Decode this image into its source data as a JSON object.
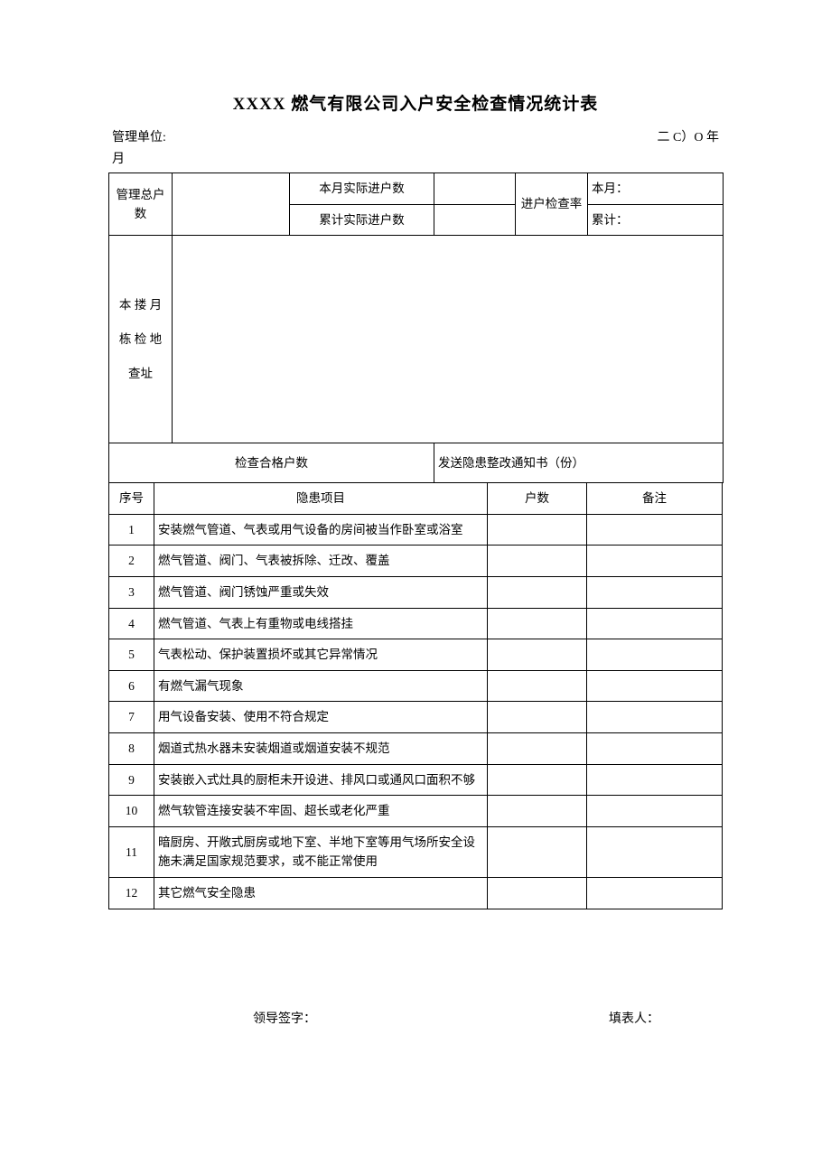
{
  "title": "XXXX 燃气有限公司入户安全检查情况统计表",
  "meta": {
    "unit_label": "管理单位:",
    "year_label": "二 C）O 年",
    "month_label": "月"
  },
  "upper": {
    "mgmt_total": "管理总户数",
    "this_month_actual": "本月实际进户数",
    "cumu_actual": "累计实际进户数",
    "entry_rate": "进户检查率",
    "this_month": "本月：",
    "cumu": "累计：",
    "block_addr_a": "本 搂 月",
    "block_addr_b": "栋 检 地",
    "block_addr_c": "查址",
    "qualified": "检查合格户数",
    "notice": "发送隐患整改通知书（份）"
  },
  "cols": {
    "seq": "序号",
    "hazard": "隐患项目",
    "count": "户数",
    "remark": "备注"
  },
  "rows": [
    {
      "no": "1",
      "item": "安装燃气管道、气表或用气设备的房间被当作卧室或浴室"
    },
    {
      "no": "2",
      "item": "燃气管道、阀门、气表被拆除、迁改、覆盖"
    },
    {
      "no": "3",
      "item": "燃气管道、阀门锈蚀严重或失效"
    },
    {
      "no": "4",
      "item": "燃气管道、气表上有重物或电线搭挂"
    },
    {
      "no": "5",
      "item": "气表松动、保护装置损坏或其它异常情况"
    },
    {
      "no": "6",
      "item": "有燃气漏气现象"
    },
    {
      "no": "7",
      "item": "用气设备安装、使用不符合规定"
    },
    {
      "no": "8",
      "item": "烟道式热水器未安装烟道或烟道安装不规范"
    },
    {
      "no": "9",
      "item": "安装嵌入式灶具的厨柜未开设进、排风口或通风口面积不够"
    },
    {
      "no": "10",
      "item": "燃气软管连接安装不牢固、超长或老化严重"
    },
    {
      "no": "11",
      "item": "暗厨房、开敞式厨房或地下室、半地下室等用气场所安全设施未满足国家规范要求，或不能正常使用"
    },
    {
      "no": "12",
      "item": "其它燃气安全隐患"
    }
  ],
  "footer": {
    "leader": "领导签字：",
    "filler": "填表人："
  }
}
